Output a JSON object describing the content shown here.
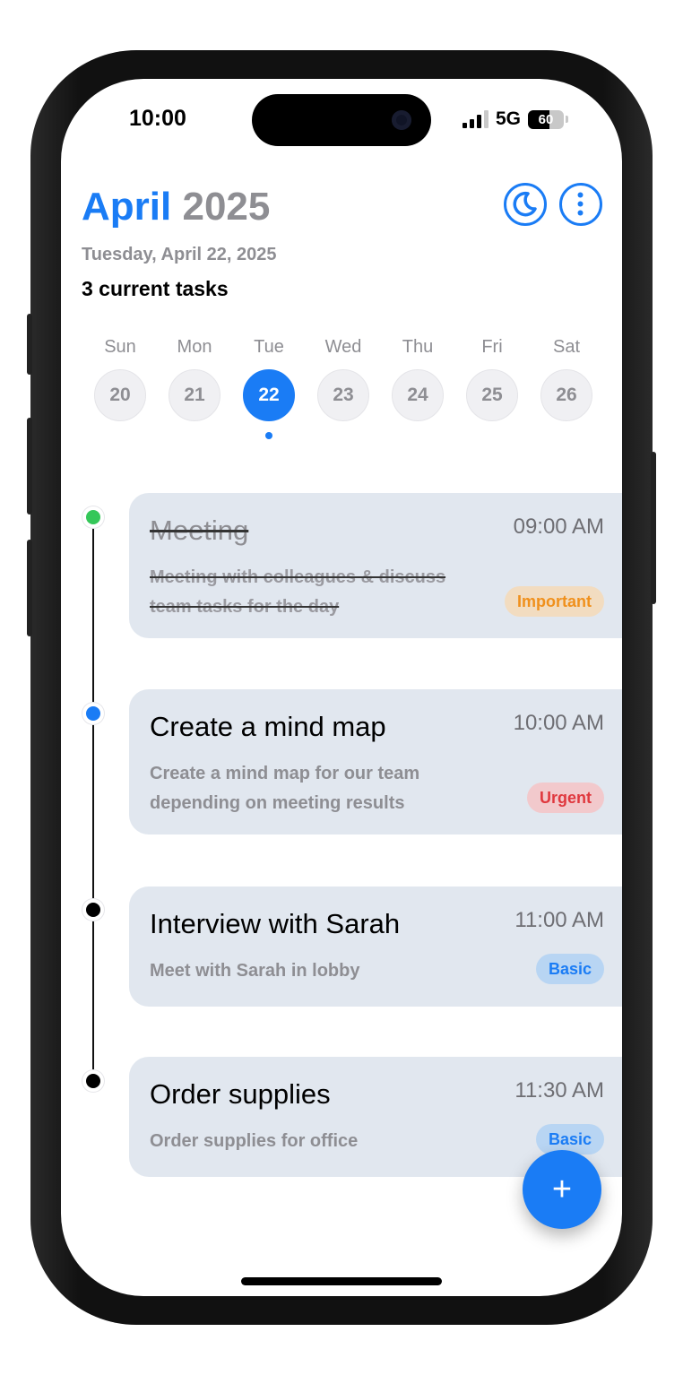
{
  "status_bar": {
    "time": "10:00",
    "network": "5G",
    "battery": "60",
    "battery_level": 0.6,
    "signal_bars": 3
  },
  "header": {
    "month": "April",
    "year": "2025",
    "full_date": "Tuesday, April 22, 2025",
    "task_count": "3 current tasks",
    "icons": [
      "moon-icon",
      "more-vertical-icon"
    ]
  },
  "week": [
    {
      "label": "Sun",
      "num": "20",
      "selected": false
    },
    {
      "label": "Mon",
      "num": "21",
      "selected": false
    },
    {
      "label": "Tue",
      "num": "22",
      "selected": true
    },
    {
      "label": "Wed",
      "num": "23",
      "selected": false
    },
    {
      "label": "Thu",
      "num": "24",
      "selected": false
    },
    {
      "label": "Fri",
      "num": "25",
      "selected": false
    },
    {
      "label": "Sat",
      "num": "26",
      "selected": false
    }
  ],
  "tasks": [
    {
      "title": "Meeting",
      "time": "09:00 AM",
      "desc": "Meeting with colleagues & discuss team tasks for the day",
      "tag": "Important",
      "completed": true,
      "dot_color": "#34c759"
    },
    {
      "title": "Create a mind map",
      "time": "10:00 AM",
      "desc": "Create a mind map for our team depending on meeting results",
      "tag": "Urgent",
      "completed": false,
      "dot_color": "#1a7cf5"
    },
    {
      "title": "Interview with Sarah",
      "time": "11:00 AM",
      "desc": "Meet with Sarah in lobby",
      "tag": "Basic",
      "completed": false,
      "dot_color": "#000000"
    },
    {
      "title": "Order supplies",
      "time": "11:30 AM",
      "desc": "Order supplies for office",
      "tag": "Basic",
      "completed": false,
      "dot_color": "#000000"
    }
  ],
  "fab": {
    "label": "+"
  },
  "colors": {
    "accent": "#1a7cf5",
    "important": "#f0901c",
    "urgent": "#e0383e",
    "basic": "#1a7cf5",
    "card_bg": "#e1e7ef"
  }
}
